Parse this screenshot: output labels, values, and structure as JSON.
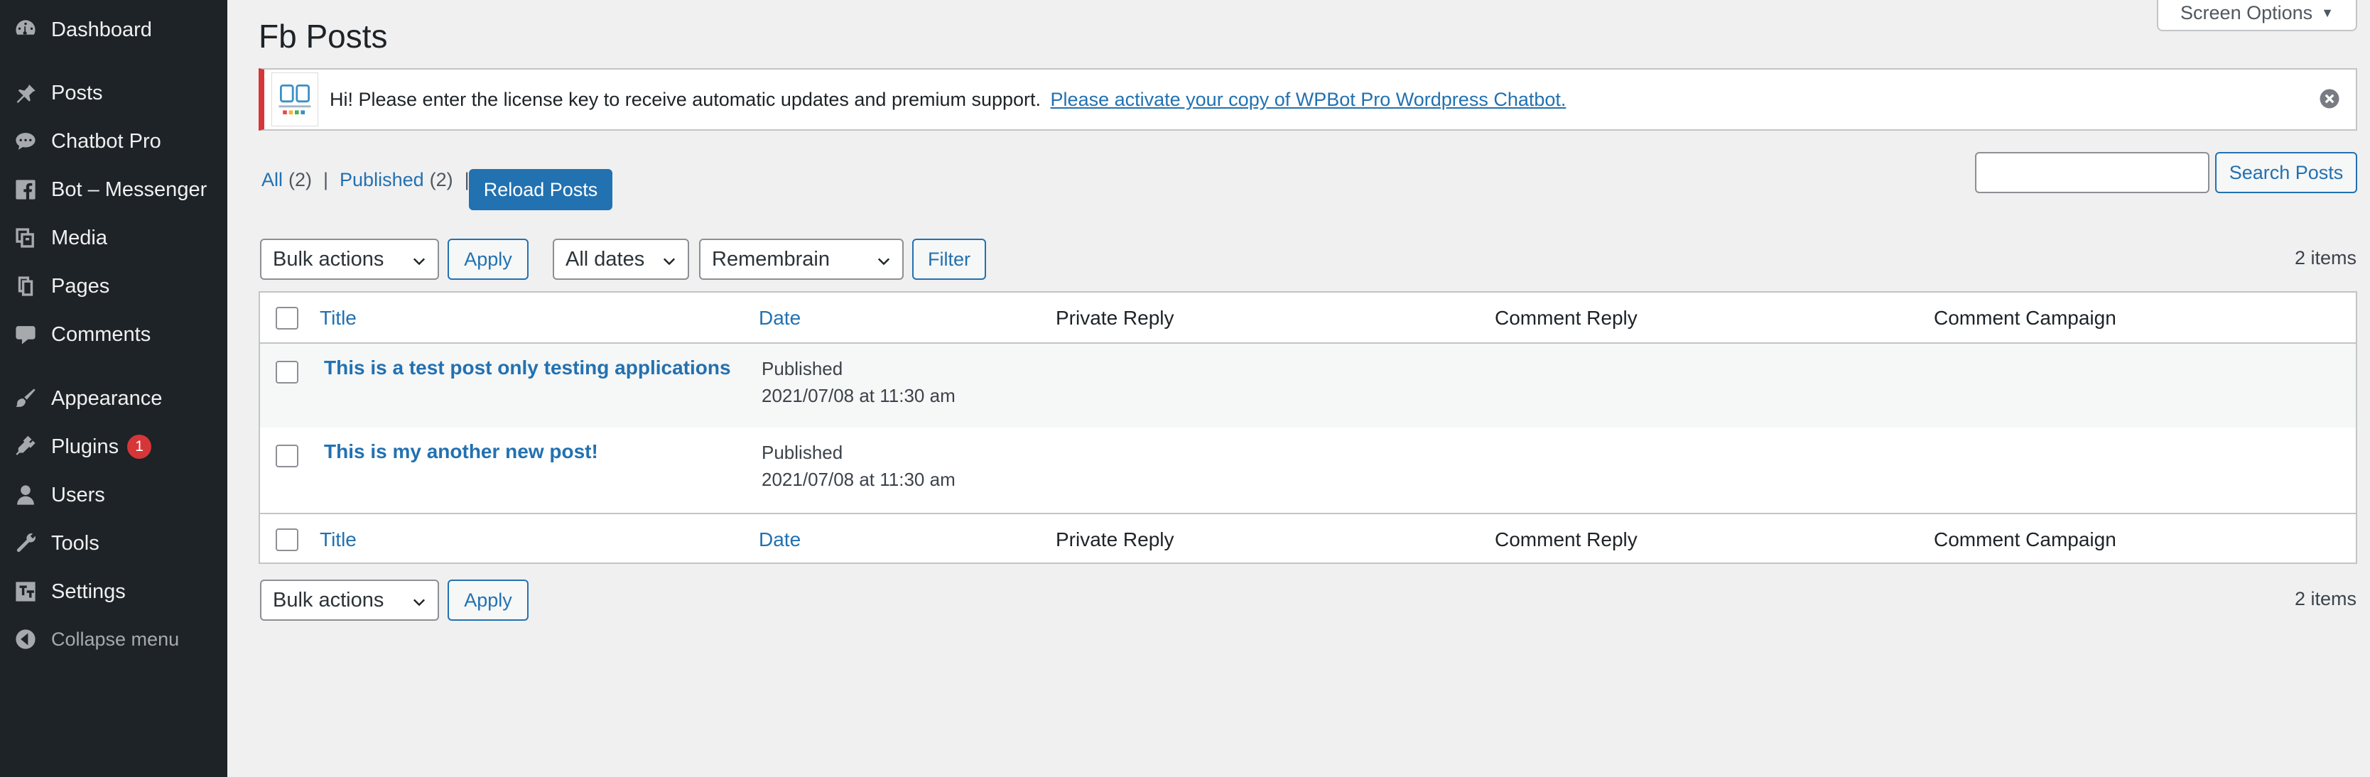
{
  "sidebar": {
    "items": [
      {
        "label": "Dashboard",
        "icon": "dashboard-icon"
      },
      {
        "label": "Posts",
        "icon": "pushpin-icon"
      },
      {
        "label": "Chatbot Pro",
        "icon": "speech-bubble-icon"
      },
      {
        "label": "Bot – Messenger",
        "icon": "facebook-icon"
      },
      {
        "label": "Media",
        "icon": "media-icon"
      },
      {
        "label": "Pages",
        "icon": "pages-icon"
      },
      {
        "label": "Comments",
        "icon": "comment-icon"
      },
      {
        "label": "Appearance",
        "icon": "paintbrush-icon"
      },
      {
        "label": "Plugins",
        "icon": "plugin-icon",
        "badge": "1"
      },
      {
        "label": "Users",
        "icon": "user-icon"
      },
      {
        "label": "Tools",
        "icon": "wrench-icon"
      },
      {
        "label": "Settings",
        "icon": "settings-icon"
      }
    ],
    "collapse_label": "Collapse menu"
  },
  "header": {
    "title": "Fb Posts",
    "screen_options": "Screen Options"
  },
  "notice": {
    "text": "Hi! Please enter the license key to receive automatic updates and premium support.",
    "link": "Please activate your copy of WPBot Pro Wordpress Chatbot."
  },
  "views": {
    "all_label": "All",
    "all_count": "(2)",
    "published_label": "Published",
    "published_count": "(2)",
    "separator": "|"
  },
  "reload_button": "Reload Posts",
  "search": {
    "value": "",
    "button": "Search Posts"
  },
  "top_nav": {
    "bulk_actions": "Bulk actions",
    "apply": "Apply",
    "dates": "All dates",
    "page_filter": "Remembrain",
    "filter": "Filter",
    "items": "2 items"
  },
  "table": {
    "columns": [
      "Title",
      "Date",
      "Private Reply",
      "Comment Reply",
      "Comment Campaign"
    ],
    "rows": [
      {
        "title": "This is a test post only testing applications",
        "status": "Published",
        "date": "2021/07/08 at 11:30 am"
      },
      {
        "title": "This is my another new post!",
        "status": "Published",
        "date": "2021/07/08 at 11:30 am"
      }
    ]
  },
  "bottom_nav": {
    "bulk_actions": "Bulk actions",
    "apply": "Apply",
    "items": "2 items"
  },
  "colors": {
    "sidebar_bg": "#1d2327",
    "accent": "#2271b1",
    "page_bg": "#f0f0f1",
    "notice_border": "#d63638"
  }
}
